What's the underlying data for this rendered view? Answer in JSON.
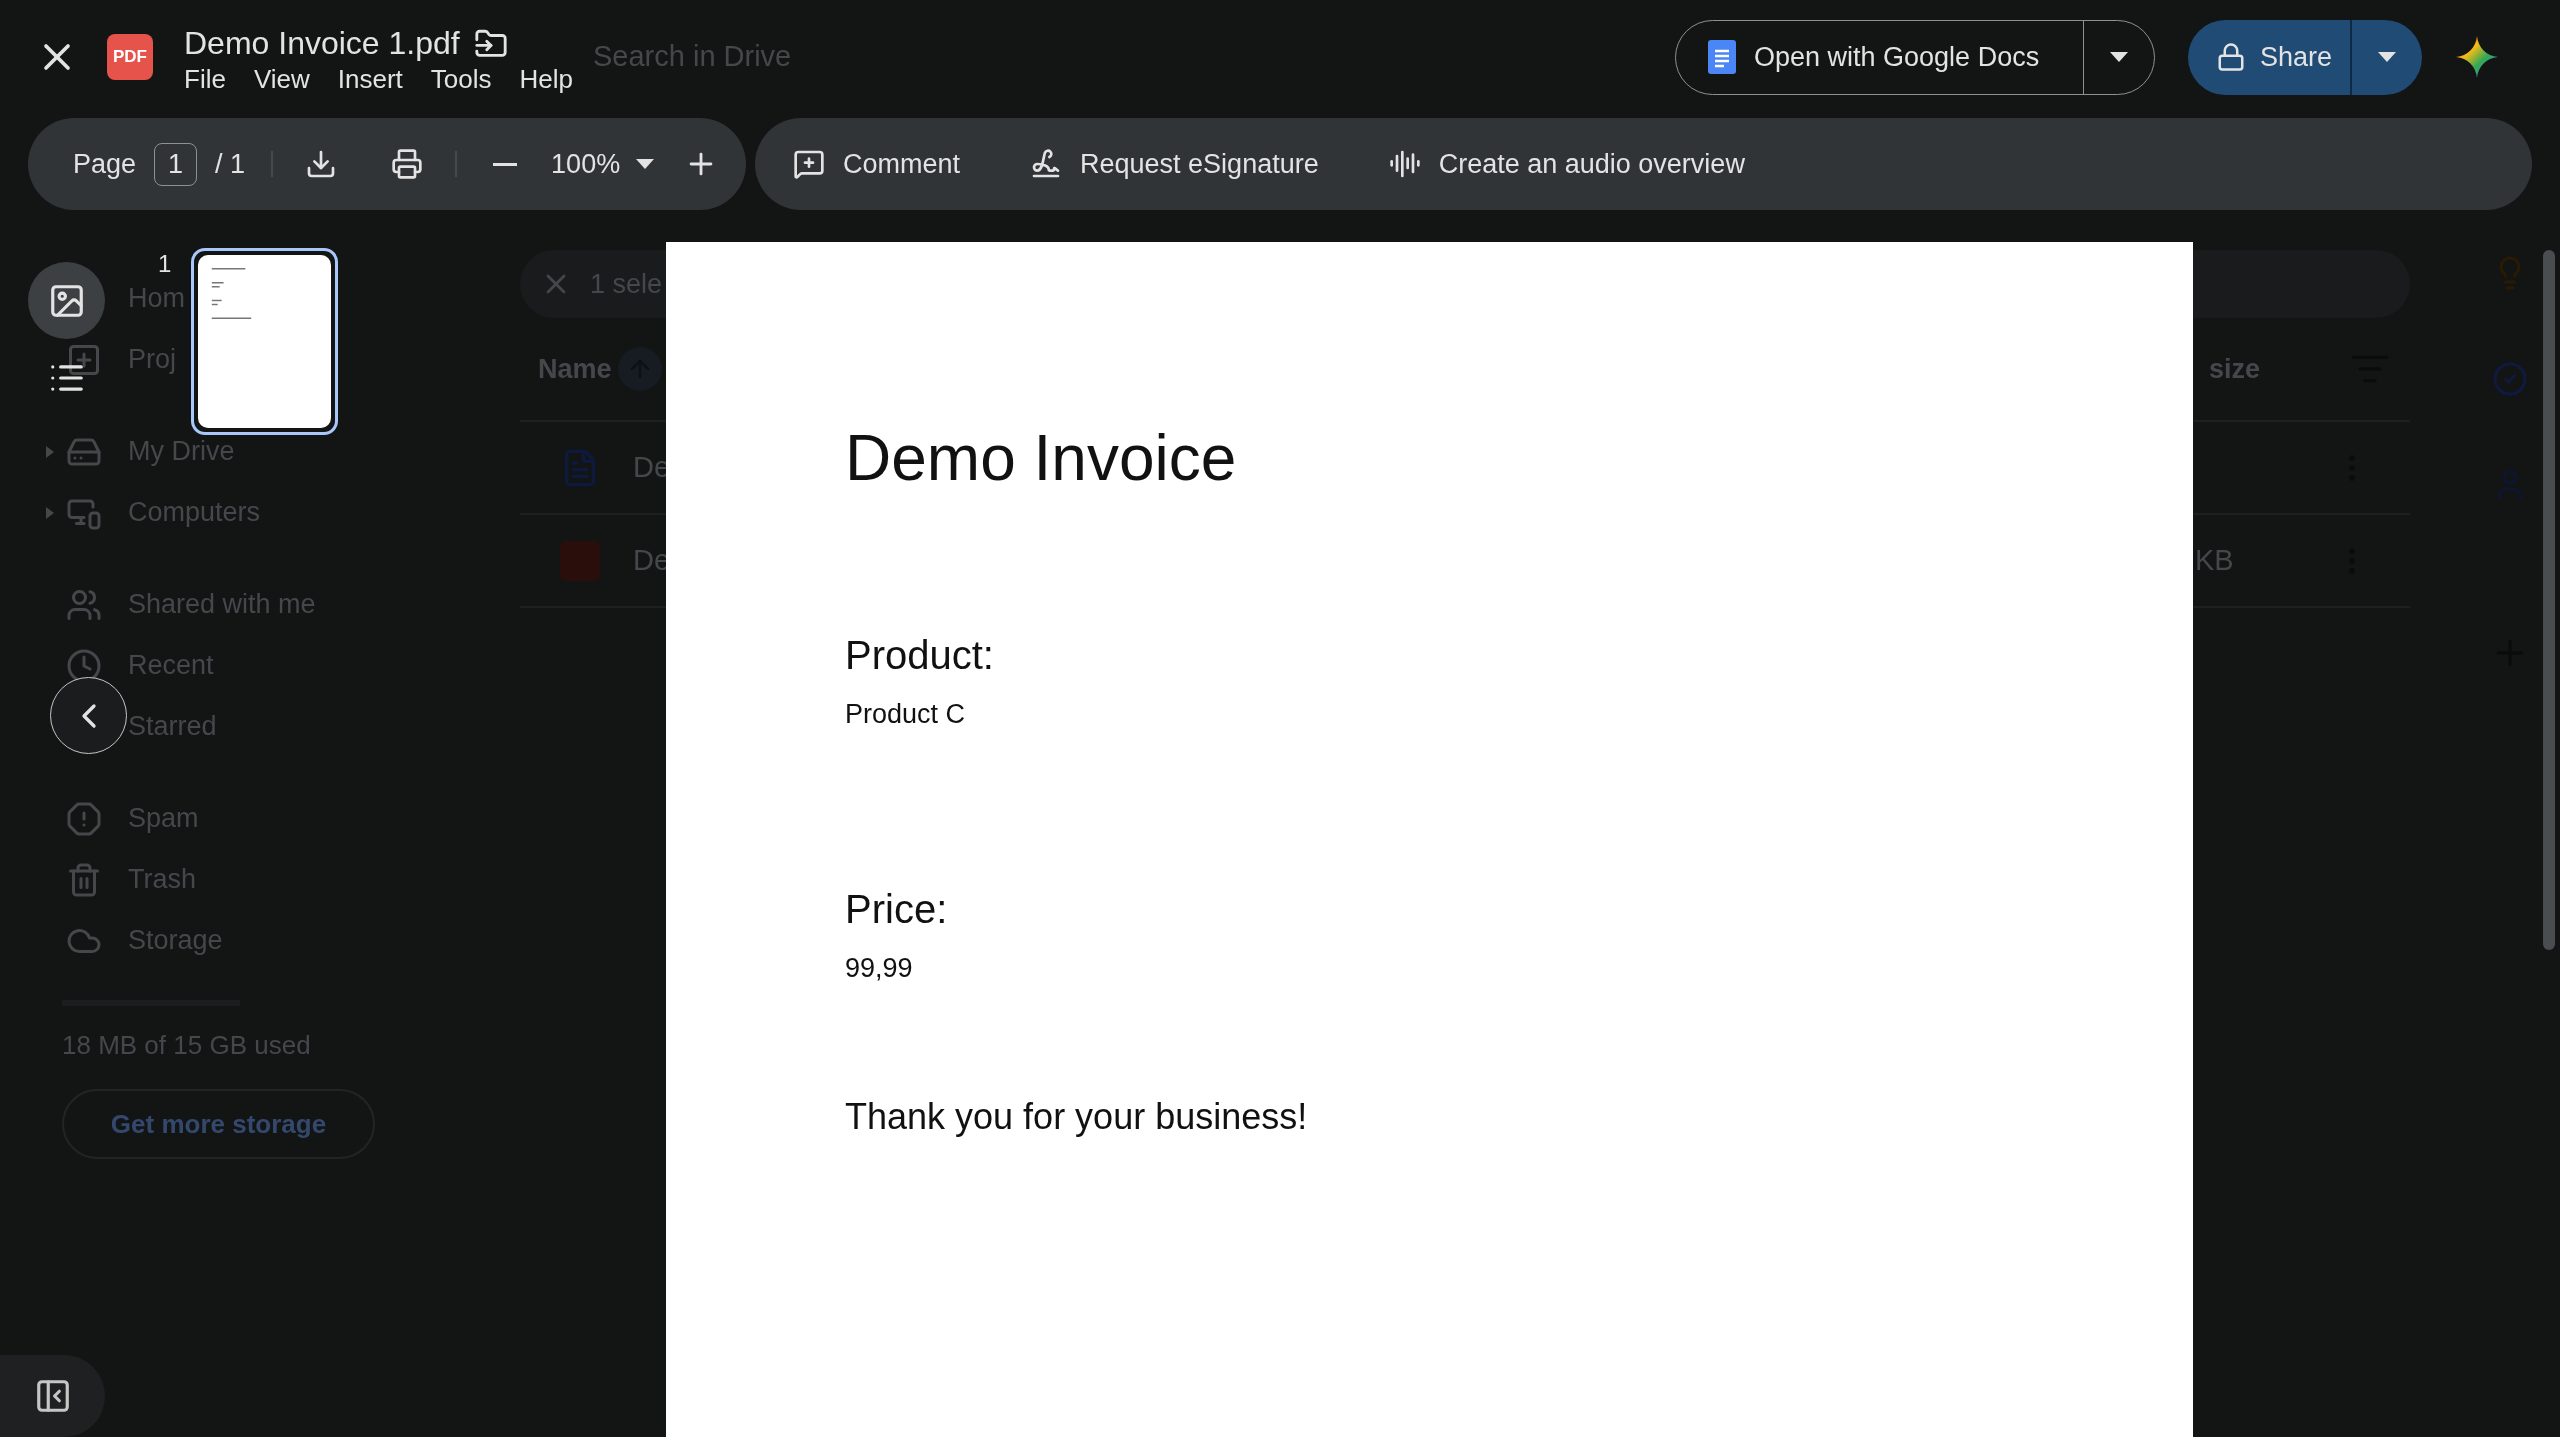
{
  "background": {
    "search_placeholder": "Search in Drive",
    "nav_groups": [
      [
        {
          "kind": "home",
          "label": "Hom"
        },
        {
          "kind": "projects",
          "label": "Proj"
        }
      ],
      [
        {
          "kind": "drive",
          "label": "My Drive"
        },
        {
          "kind": "computers",
          "label": "Computers"
        }
      ],
      [
        {
          "kind": "shared",
          "label": "Shared with me"
        },
        {
          "kind": "recent",
          "label": "Recent"
        },
        {
          "kind": "starred",
          "label": "Starred"
        }
      ],
      [
        {
          "kind": "spam",
          "label": "Spam"
        },
        {
          "kind": "trash",
          "label": "Trash"
        },
        {
          "kind": "storage",
          "label": "Storage"
        }
      ]
    ],
    "storage_text": "18 MB of 15 GB used",
    "storage_button": "Get more storage",
    "selection": "1 sele",
    "columns": [
      "Name",
      "size"
    ],
    "rows": [
      {
        "kind": "doc",
        "name": "De"
      },
      {
        "kind": "pdf",
        "name": "De",
        "size": "KB"
      }
    ]
  },
  "viewer": {
    "badge": "PDF",
    "title": "Demo Invoice 1.pdf",
    "menu": [
      "File",
      "View",
      "Insert",
      "Tools",
      "Help"
    ],
    "open_with": "Open with Google Docs",
    "share": "Share"
  },
  "toolbar": {
    "page_label": "Page",
    "page_value": "1",
    "page_total": "/ 1",
    "zoom": "100%",
    "actions": [
      {
        "kind": "comment",
        "label": "Comment"
      },
      {
        "kind": "signature",
        "label": "Request eSignature"
      },
      {
        "kind": "audio",
        "label": "Create an audio overview"
      }
    ]
  },
  "thumbnails": [
    {
      "number": "1",
      "selected": true
    }
  ],
  "document": {
    "title": "Demo Invoice",
    "sections": [
      {
        "heading": "Product:",
        "value": "Product C"
      },
      {
        "heading": "Price:",
        "value": "99,99"
      }
    ],
    "closing": "Thank you for your business!"
  }
}
